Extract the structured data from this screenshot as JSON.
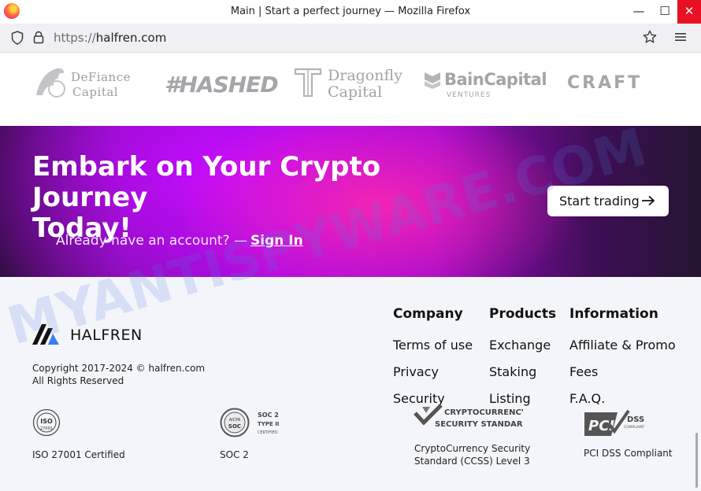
{
  "browser": {
    "window_title": "Main | Start a perfect journey — Mozilla Firefox",
    "url_protocol": "https://",
    "url_host": "halfren.com"
  },
  "partners": {
    "defiance_line1": "DeFiance",
    "defiance_line2": "Capital",
    "hashed": "#HASHED",
    "dragonfly_line1": "Dragonfly",
    "dragonfly_line2": "Capital",
    "bain": "BainCapital",
    "bain_sub": "VENTURES",
    "craft": "CRAFT"
  },
  "banner": {
    "title_line1": "Embark on Your Crypto Journey",
    "title_line2": "Today!",
    "cta_label": "Start trading",
    "already_text": "Already have an account? —",
    "signin_label": "Sign In",
    "colors": {
      "magenta": "#c20bff",
      "pink": "#ff28aa",
      "dark": "#2a0c38"
    }
  },
  "footer": {
    "brand_name": "HALFREN",
    "copyright_line1": "Copyright 2017-2024 © halfren.com",
    "copyright_line2": "All Rights Reserved",
    "columns": [
      {
        "heading": "Company",
        "links": [
          "Terms of use",
          "Privacy",
          "Security"
        ]
      },
      {
        "heading": "Products",
        "links": [
          "Exchange",
          "Staking",
          "Listing"
        ]
      },
      {
        "heading": "Information",
        "links": [
          "Affiliate & Promo",
          "Fees",
          "F.A.Q."
        ]
      }
    ],
    "certs": {
      "iso": "ISO 27001 Certified",
      "soc": "SOC 2",
      "ccss_line1": "CryptoCurrency Security",
      "ccss_line2": "Standard (CCSS) Level 3",
      "pci": "PCI DSS Compliant"
    },
    "cert_logos": {
      "iso_text": "ISO",
      "iso_num": "27001",
      "aicpa": "AICPA",
      "soc_badge": "SOC",
      "soc_2": "SOC 2",
      "soc_type": "TYPE II",
      "soc_certified": "CERTIFIED",
      "ccss_top": "CRYPTOCURRENCY",
      "ccss_bottom": "SECURITY STANDARD",
      "pci": "PCI",
      "dss": "DSS",
      "dss_sub": "COMPLIANT"
    }
  },
  "watermark": "MYANTISPYWARE.COM"
}
